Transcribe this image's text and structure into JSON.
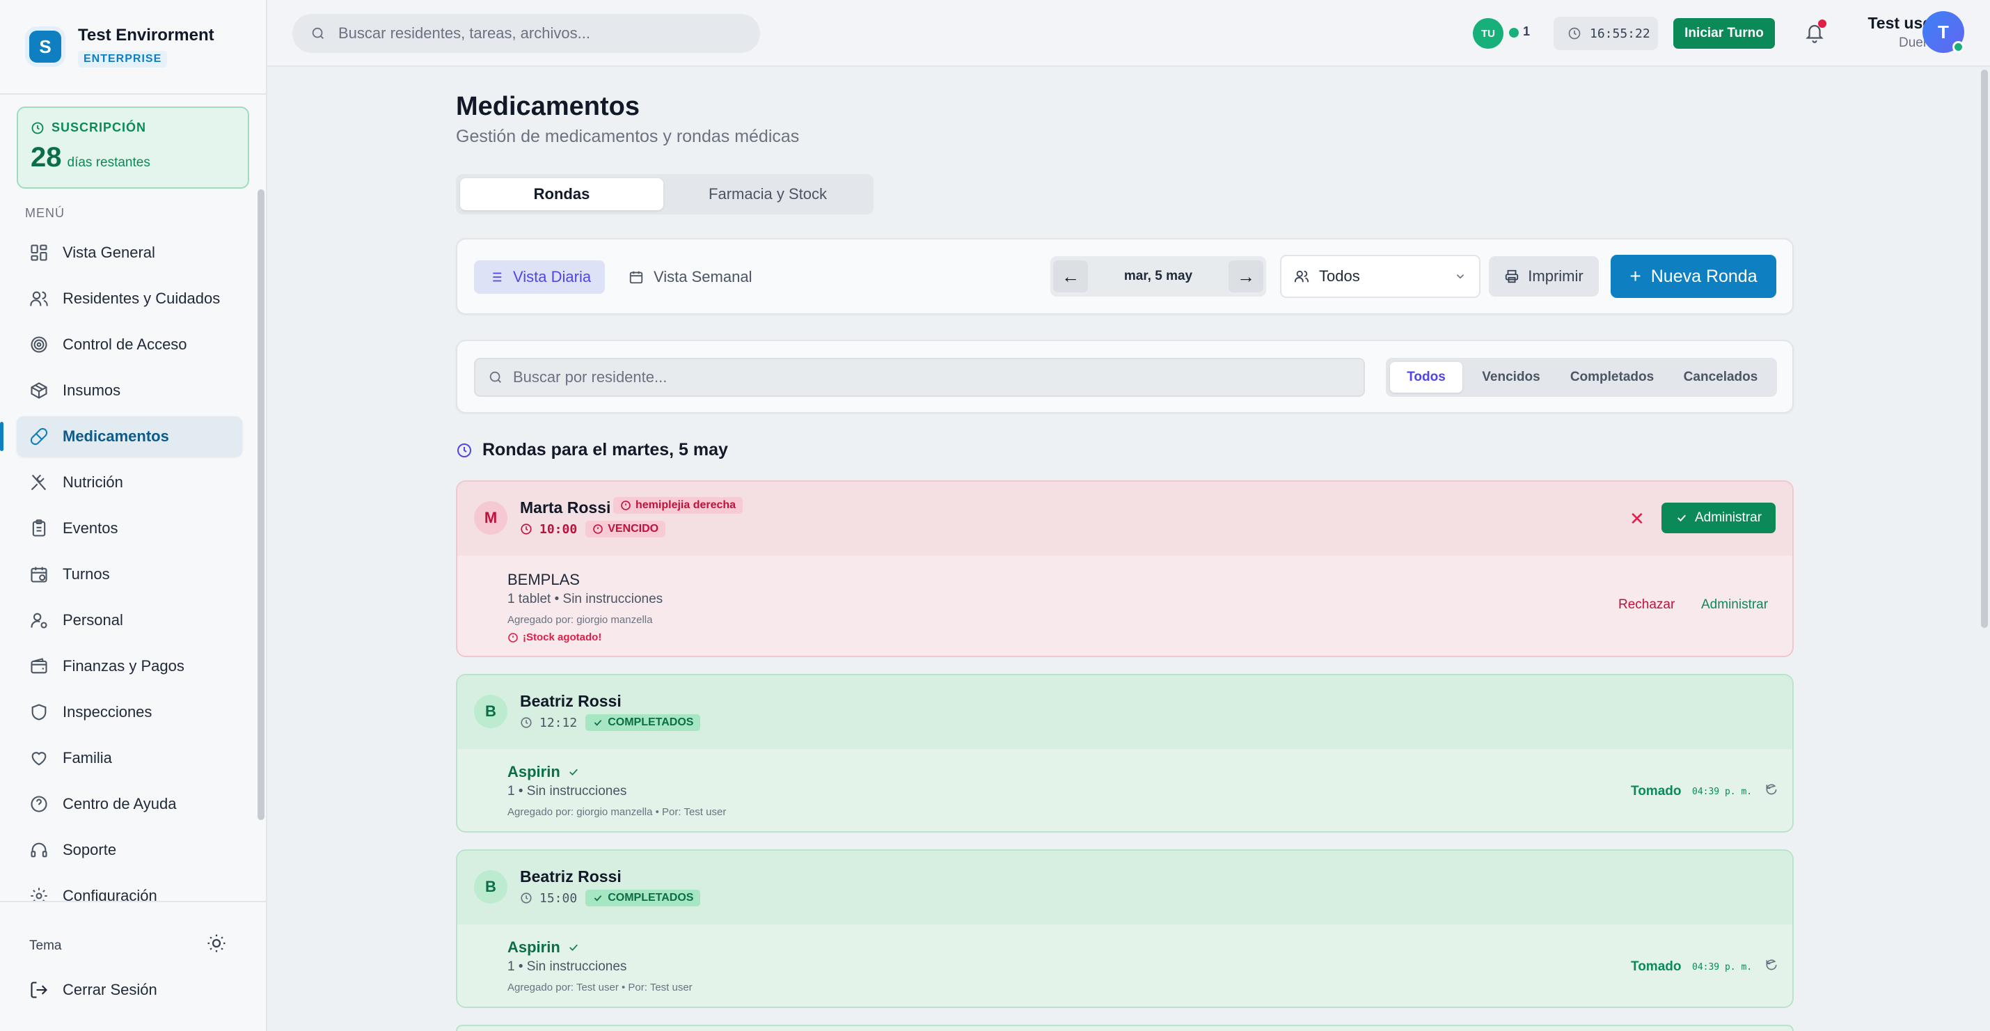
{
  "brand": {
    "name": "Test Envirorment",
    "tier": "ENTERPRISE",
    "logo_letter": "S"
  },
  "subscription": {
    "title": "SUSCRIPCIÓN",
    "days": "28",
    "days_label": "días restantes"
  },
  "menu": {
    "title": "MENÚ",
    "items": [
      {
        "label": "Vista General",
        "icon": "grid-icon"
      },
      {
        "label": "Residentes y Cuidados",
        "icon": "users-icon"
      },
      {
        "label": "Control de Acceso",
        "icon": "target-icon"
      },
      {
        "label": "Insumos",
        "icon": "box-icon"
      },
      {
        "label": "Medicamentos",
        "icon": "pill-icon",
        "active": true
      },
      {
        "label": "Nutrición",
        "icon": "utensils-icon"
      },
      {
        "label": "Eventos",
        "icon": "clipboard-icon"
      },
      {
        "label": "Turnos",
        "icon": "calendar-clock-icon"
      },
      {
        "label": "Personal",
        "icon": "user-gear-icon"
      },
      {
        "label": "Finanzas y Pagos",
        "icon": "wallet-icon"
      },
      {
        "label": "Inspecciones",
        "icon": "shield-icon"
      },
      {
        "label": "Familia",
        "icon": "heart-icon"
      },
      {
        "label": "Centro de Ayuda",
        "icon": "help-icon"
      },
      {
        "label": "Soporte",
        "icon": "headset-icon"
      },
      {
        "label": "Configuración",
        "icon": "gear-icon"
      }
    ]
  },
  "sidebar_footer": {
    "theme_label": "Tema",
    "logout_label": "Cerrar Sesión"
  },
  "topbar": {
    "search_placeholder": "Buscar residentes, tareas, archivos...",
    "online_initials": "TU",
    "online_count": "1",
    "clock": "16:55:22",
    "start_shift": "Iniciar Turno",
    "user_name": "Test user",
    "user_role": "Dueño",
    "user_initial": "T"
  },
  "page": {
    "title": "Medicamentos",
    "subtitle": "Gestión de medicamentos y rondas médicas",
    "tabs": [
      "Rondas",
      "Farmacia y Stock"
    ]
  },
  "toolbar": {
    "daily": "Vista Diaria",
    "weekly": "Vista Semanal",
    "prev": "←",
    "next": "→",
    "date": "mar, 5 may",
    "filter": "Todos",
    "print": "Imprimir",
    "new_round": "Nueva Ronda"
  },
  "filters": {
    "search_placeholder": "Buscar por residente...",
    "tabs": [
      "Todos",
      "Vencidos",
      "Completados",
      "Cancelados"
    ]
  },
  "section_title": "Rondas para el martes, 5 may",
  "rounds": [
    {
      "initial": "M",
      "name": "Marta Rossi",
      "condition": "hemiplejia derecha",
      "time": "10:00",
      "status": "VENCIDO",
      "admin_label": "Administrar",
      "close": "✕",
      "med": {
        "name": "BEMPLAS",
        "dose": "1 tablet • Sin instrucciones",
        "by": "Agregado por: giorgio manzella",
        "warning": "¡Stock agotado!"
      },
      "reject": "Rechazar",
      "administer": "Administrar"
    },
    {
      "initial": "B",
      "name": "Beatriz Rossi",
      "time": "12:12",
      "status": "COMPLETADOS",
      "med": {
        "name": "Aspirin",
        "dose": "1 • Sin instrucciones",
        "by": "Agregado por: giorgio manzella • Por: Test user"
      },
      "taken": "Tomado",
      "taken_time": "04:39 p. m."
    },
    {
      "initial": "B",
      "name": "Beatriz Rossi",
      "time": "15:00",
      "status": "COMPLETADOS",
      "med": {
        "name": "Aspirin",
        "dose": "1 • Sin instrucciones",
        "by": "Agregado por: Test user • Por: Test user"
      },
      "taken": "Tomado",
      "taken_time": "04:39 p. m."
    }
  ],
  "colors": {
    "primary": "#0e7fc0",
    "success": "#0b8a58",
    "danger": "#e11d48",
    "accent": "#4f46e5"
  }
}
